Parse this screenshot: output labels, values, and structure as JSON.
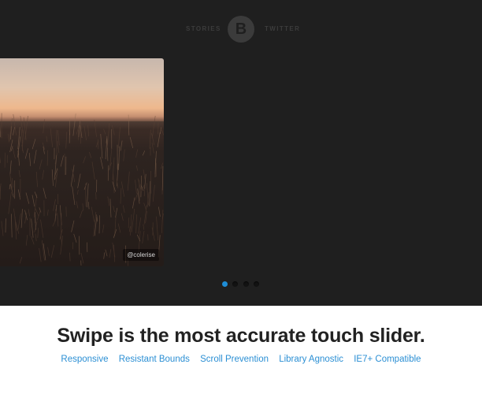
{
  "nav": {
    "left_link": "STORIES",
    "logo_letter": "B",
    "right_link": "TWITTER"
  },
  "slider": {
    "photo_credit": "@colerise",
    "slide_count": 4,
    "active_index": 0
  },
  "headline": "Swipe is the most accurate touch slider.",
  "features": [
    "Responsive",
    "Resistant Bounds",
    "Scroll Prevention",
    "Library Agnostic",
    "IE7+ Compatible"
  ],
  "colors": {
    "dark_background": "#1f1f1f",
    "accent": "#2b8fd4",
    "active_dot": "#1e8dd6"
  }
}
